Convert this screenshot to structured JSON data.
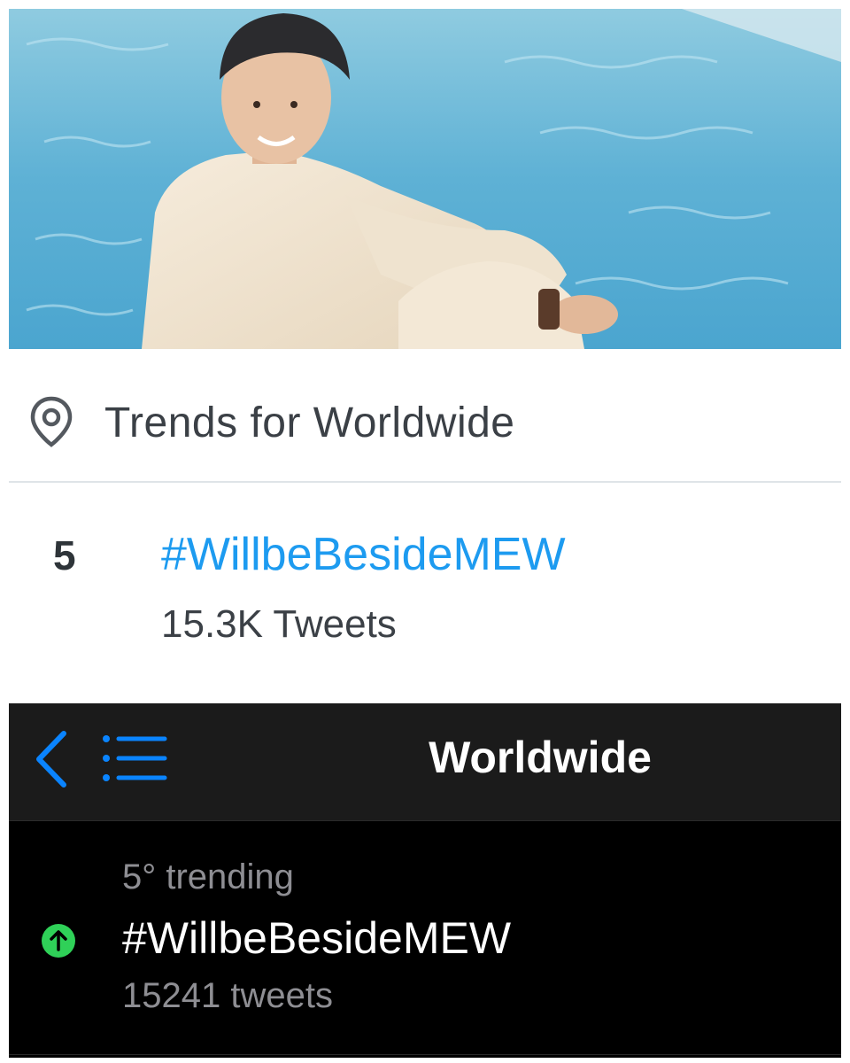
{
  "photo": {
    "subject": "person-sitting-by-pool-photo"
  },
  "trends_card": {
    "title": "Trends for Worldwide",
    "item": {
      "rank": "5",
      "hashtag": "#WillbeBesideMEW",
      "tweets": "15.3K Tweets"
    },
    "accent_color": "#1d9bf0"
  },
  "trends_app": {
    "nav_title": "Worldwide",
    "item": {
      "rank_label": "5° trending",
      "hashtag": "#WillbeBesideMEW",
      "tweets": "15241 tweets",
      "trend_direction_icon": "arrow-up-icon"
    },
    "accent_color": "#0a84ff",
    "up_color": "#2fd158"
  }
}
